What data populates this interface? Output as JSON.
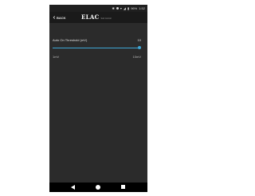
{
  "status_bar": {
    "time": "1:52",
    "battery": "96%",
    "icons": [
      "bluetooth-icon",
      "mute-icon",
      "wifi-icon",
      "signal-icon",
      "battery-icon"
    ]
  },
  "header": {
    "back_label": "BACK",
    "logo_text": "ELAC",
    "logo_subtitle": "Sub Control",
    "background_color": "#1a1a1a"
  },
  "setting": {
    "label": "Auto On Threshold (mV)",
    "value": "10",
    "min_label": "1mV",
    "max_label": "10mV",
    "value_fraction": 1.0,
    "accent_color": "#3fa7d6"
  },
  "nav_bar": {
    "icons": [
      "nav-back-icon",
      "nav-home-icon",
      "nav-recents-icon"
    ]
  }
}
